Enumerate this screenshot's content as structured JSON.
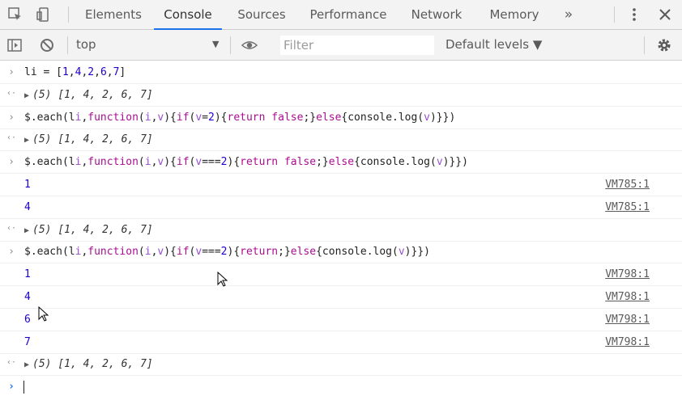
{
  "tabs": [
    {
      "label": "Elements",
      "active": false
    },
    {
      "label": "Console",
      "active": true
    },
    {
      "label": "Sources",
      "active": false
    },
    {
      "label": "Performance",
      "active": false
    },
    {
      "label": "Network",
      "active": false
    },
    {
      "label": "Memory",
      "active": false
    }
  ],
  "more_tabs_icon": "»",
  "toolbar": {
    "context": "top",
    "filter_placeholder": "Filter",
    "levels": "Default levels ▼"
  },
  "console_lines": [
    {
      "type": "input",
      "code": "li = [1,4,2,6,7]"
    },
    {
      "type": "result",
      "count": "(5)",
      "value": "[1, 4, 2, 6, 7]"
    },
    {
      "type": "input",
      "code": "$.each(li,function(i,v){if(v=2){return false;}else{console.log(v)}})"
    },
    {
      "type": "result",
      "count": "(5)",
      "value": "[1, 4, 2, 6, 7]"
    },
    {
      "type": "input",
      "code": "$.each(li,function(i,v){if(v===2){return false;}else{console.log(v)}})"
    },
    {
      "type": "log",
      "value": "1",
      "source": "VM785:1"
    },
    {
      "type": "log",
      "value": "4",
      "source": "VM785:1"
    },
    {
      "type": "result",
      "count": "(5)",
      "value": "[1, 4, 2, 6, 7]"
    },
    {
      "type": "input",
      "code": "$.each(li,function(i,v){if(v===2){return;}else{console.log(v)}})"
    },
    {
      "type": "log",
      "value": "1",
      "source": "VM798:1"
    },
    {
      "type": "log",
      "value": "4",
      "source": "VM798:1"
    },
    {
      "type": "log",
      "value": "6",
      "source": "VM798:1"
    },
    {
      "type": "log",
      "value": "7",
      "source": "VM798:1"
    },
    {
      "type": "result",
      "count": "(5)",
      "value": "[1, 4, 2, 6, 7]"
    },
    {
      "type": "prompt",
      "code": ""
    }
  ],
  "colors": {
    "accent": "#1a73e8",
    "number": "#1c00cf",
    "keyword": "#aa0d91"
  }
}
